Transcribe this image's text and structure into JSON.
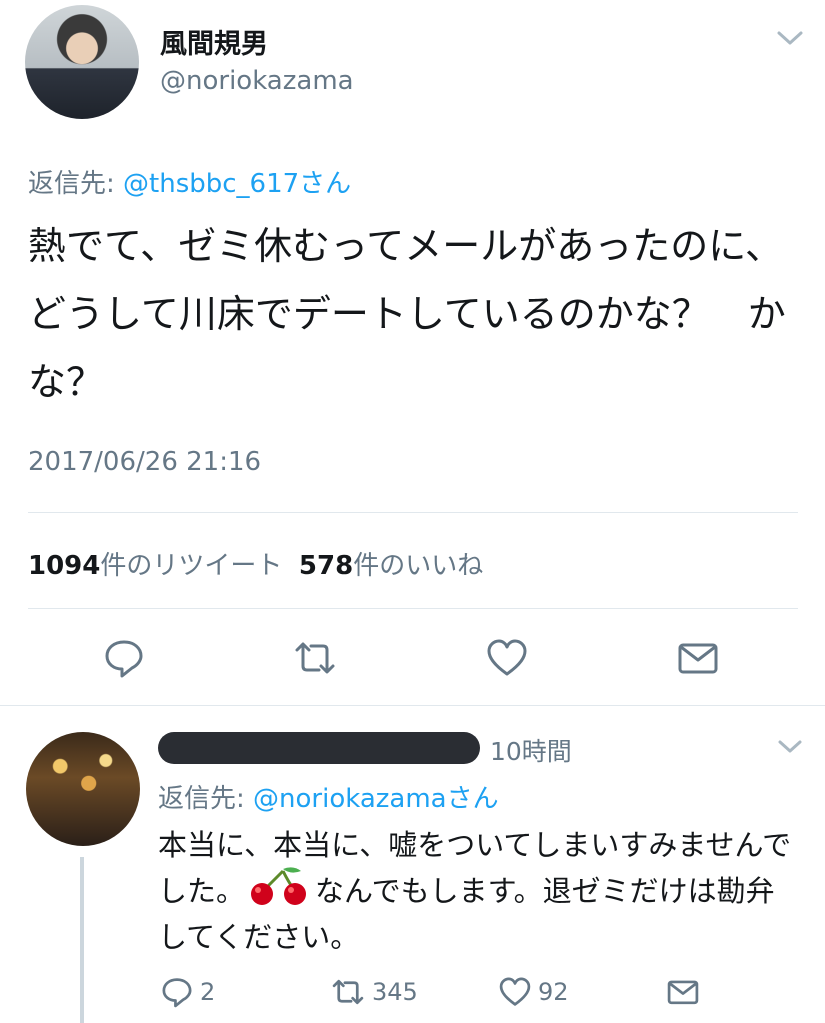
{
  "tweet": {
    "author_name": "風間規男",
    "author_handle": "@noriokazama",
    "reply_to_prefix": "返信先: ",
    "reply_to_handle": "@thsbbc_617さん",
    "text": "熱でて、ゼミ休むってメールがあったのに、どうして川床でデートしているのかな？　かな？",
    "timestamp": "2017/06/26 21:16",
    "retweet_count": "1094",
    "retweet_label": "件のリツイート",
    "like_count": "578",
    "like_label": "件のいいね"
  },
  "reply": {
    "time": "10時間",
    "reply_to_prefix": "返信先: ",
    "reply_to_handle": "@noriokazamaさん",
    "text_part1": "本当に、本当に、嘘をついてしまいすみませんでした。",
    "text_part2": "なんでもします。退ゼミだけは勘弁してください。",
    "reply_count": "2",
    "retweet_count": "345",
    "like_count": "92"
  },
  "icons": {
    "chevron": "chevron-down-icon",
    "reply": "reply-icon",
    "retweet": "retweet-icon",
    "like": "heart-icon",
    "dm": "envelope-icon",
    "emoji": "cherries-emoji"
  },
  "colors": {
    "link": "#1da1f2",
    "secondary_text": "#657786",
    "icon": "#657786",
    "divider": "#e1e8ed"
  }
}
